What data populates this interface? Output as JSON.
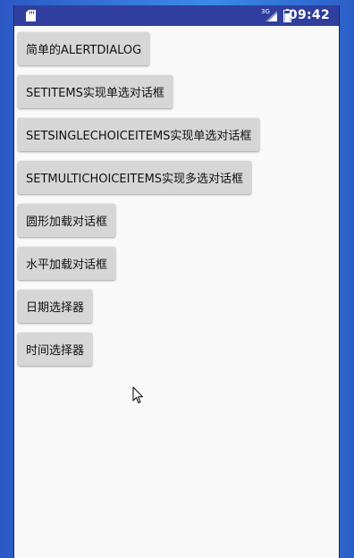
{
  "status_bar": {
    "network": "3G",
    "time": "09:42"
  },
  "buttons": [
    {
      "label": "简单的ALERTDIALOG"
    },
    {
      "label": "SETITEMS实现单选对话框"
    },
    {
      "label": "SETSINGLECHOICEITEMS实现单选对话框"
    },
    {
      "label": "SETMULTICHOICEITEMS实现多选对话框"
    },
    {
      "label": "圆形加载对话框"
    },
    {
      "label": "水平加载对话框"
    },
    {
      "label": "日期选择器"
    },
    {
      "label": "时间选择器"
    }
  ],
  "icons": {
    "sd_card": "sd-card-icon",
    "signal": "signal-icon",
    "battery": "battery-icon",
    "cursor": "mouse-pointer-icon"
  }
}
